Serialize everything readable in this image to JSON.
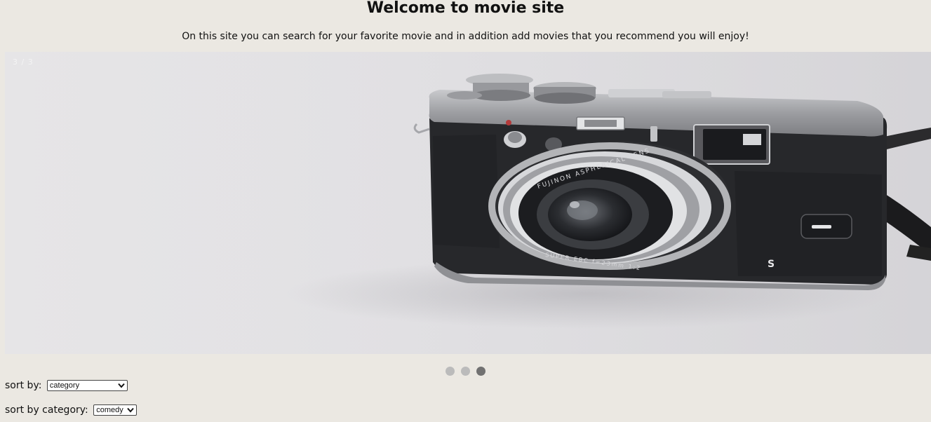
{
  "header": {
    "title": "Welcome to movie site",
    "intro": "On this site you can search for your favorite movie and in addition add movies that you recommend you will enjoy!"
  },
  "slideshow": {
    "counter": "3 / 3",
    "current_slide": 3,
    "total_slides": 3,
    "image_subject": "vintage silver-and-black rangefinder camera on a white surface",
    "lens_text_top": "FUJINON ASPHERICAL LENS",
    "lens_text_bottom": "SUPER EBC f=23mm 1:2",
    "dial_letter": "S",
    "dot_color": "#bbbbbb",
    "dot_active_color": "#717171"
  },
  "controls": {
    "sort_label": "sort by:",
    "sort_value": "category",
    "category_label": "sort by category:",
    "category_value": "comedy"
  },
  "colors": {
    "page_background": "#ebe8e2",
    "text": "#111111"
  }
}
